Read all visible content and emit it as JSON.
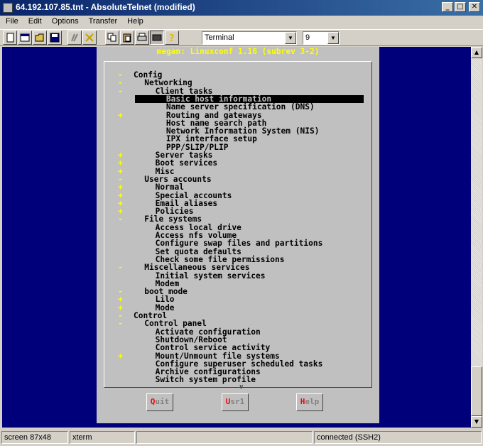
{
  "window": {
    "title": "64.192.107.85.tnt - AbsoluteTelnet (modified)"
  },
  "menu": [
    "File",
    "Edit",
    "Options",
    "Transfer",
    "Help"
  ],
  "toolbar": {
    "emulation": "Terminal",
    "font_size": "9"
  },
  "dialog": {
    "title": "megan: Linuxconf 1.16 (subrev 3-2)",
    "items": [
      {
        "text": "Config",
        "indent": 0,
        "marker": "-"
      },
      {
        "text": "Networking",
        "indent": 1,
        "marker": "-"
      },
      {
        "text": "Client tasks",
        "indent": 2,
        "marker": "-"
      },
      {
        "text": "Basic host information",
        "indent": 3,
        "marker": "",
        "selected": true
      },
      {
        "text": "Name server specification (DNS)",
        "indent": 3,
        "marker": ""
      },
      {
        "text": "Routing and gateways",
        "indent": 3,
        "marker": "+"
      },
      {
        "text": "Host name search path",
        "indent": 3,
        "marker": ""
      },
      {
        "text": "Network Information System (NIS)",
        "indent": 3,
        "marker": ""
      },
      {
        "text": "IPX interface setup",
        "indent": 3,
        "marker": ""
      },
      {
        "text": "PPP/SLIP/PLIP",
        "indent": 3,
        "marker": ""
      },
      {
        "text": "Server tasks",
        "indent": 2,
        "marker": "+"
      },
      {
        "text": "Boot services",
        "indent": 2,
        "marker": "+"
      },
      {
        "text": "Misc",
        "indent": 2,
        "marker": "+"
      },
      {
        "text": "Users accounts",
        "indent": 1,
        "marker": "-"
      },
      {
        "text": "Normal",
        "indent": 2,
        "marker": "+"
      },
      {
        "text": "Special accounts",
        "indent": 2,
        "marker": "+"
      },
      {
        "text": "Email aliases",
        "indent": 2,
        "marker": "+"
      },
      {
        "text": "Policies",
        "indent": 2,
        "marker": "+"
      },
      {
        "text": "File systems",
        "indent": 1,
        "marker": "-"
      },
      {
        "text": "Access local drive",
        "indent": 2,
        "marker": ""
      },
      {
        "text": "Access nfs volume",
        "indent": 2,
        "marker": ""
      },
      {
        "text": "Configure swap files and partitions",
        "indent": 2,
        "marker": ""
      },
      {
        "text": "Set quota defaults",
        "indent": 2,
        "marker": ""
      },
      {
        "text": "Check some file permissions",
        "indent": 2,
        "marker": ""
      },
      {
        "text": "Miscellaneous services",
        "indent": 1,
        "marker": "-"
      },
      {
        "text": "Initial system services",
        "indent": 2,
        "marker": ""
      },
      {
        "text": "Modem",
        "indent": 2,
        "marker": ""
      },
      {
        "text": "boot mode",
        "indent": 1,
        "marker": "-"
      },
      {
        "text": "Lilo",
        "indent": 2,
        "marker": "+"
      },
      {
        "text": "Mode",
        "indent": 2,
        "marker": "+"
      },
      {
        "text": "Control",
        "indent": 0,
        "marker": "-"
      },
      {
        "text": "Control panel",
        "indent": 1,
        "marker": "-"
      },
      {
        "text": "Activate configuration",
        "indent": 2,
        "marker": ""
      },
      {
        "text": "Shutdown/Reboot",
        "indent": 2,
        "marker": ""
      },
      {
        "text": "Control service activity",
        "indent": 2,
        "marker": ""
      },
      {
        "text": "Mount/Unmount file systems",
        "indent": 2,
        "marker": "+"
      },
      {
        "text": "Configure superuser scheduled tasks",
        "indent": 2,
        "marker": ""
      },
      {
        "text": "Archive configurations",
        "indent": 2,
        "marker": ""
      },
      {
        "text": "Switch system profile",
        "indent": 2,
        "marker": ""
      }
    ],
    "more_indicator": "v",
    "buttons": [
      {
        "hotkey": "Q",
        "rest": "uit"
      },
      {
        "hotkey": "U",
        "rest": "sr1"
      },
      {
        "hotkey": "H",
        "rest": "elp"
      }
    ]
  },
  "status": {
    "screen": "screen 87x48",
    "termtype": "xterm",
    "connection": "connected (SSH2)"
  },
  "colors": {
    "terminal_bg": "#00007a",
    "dialog_bg": "#c0c0c0",
    "title_text": "#ffff00",
    "marker": "#ffff00",
    "hotkey": "#ff0000"
  }
}
